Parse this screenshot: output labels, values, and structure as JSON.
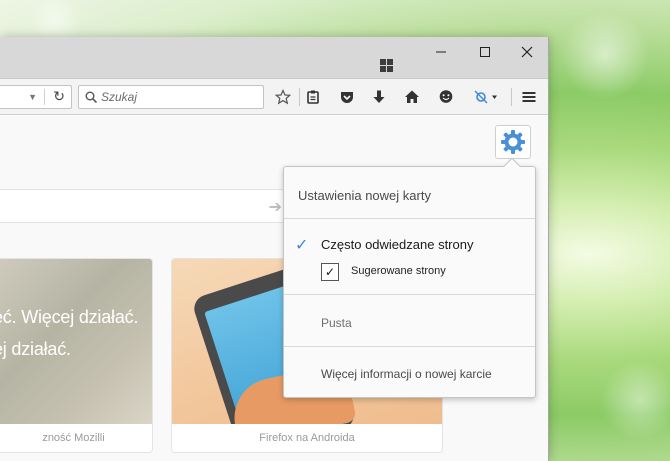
{
  "toolbar": {
    "search_placeholder": "Szukaj"
  },
  "tiles": [
    {
      "line1": "ęć. Więcej działać.",
      "line2": "ej działać.",
      "caption": "zność Mozilli"
    },
    {
      "caption": "Firefox na Androida"
    }
  ],
  "newtab_menu": {
    "title": "Ustawienia nowej karty",
    "option_top_sites": "Często odwiedzane strony",
    "checkbox_suggested": "Sugerowane strony",
    "option_blank": "Pusta",
    "more_info": "Więcej informacji o nowej karcie"
  },
  "colors": {
    "accent": "#3a8ad8",
    "gear": "#4a90d9"
  }
}
